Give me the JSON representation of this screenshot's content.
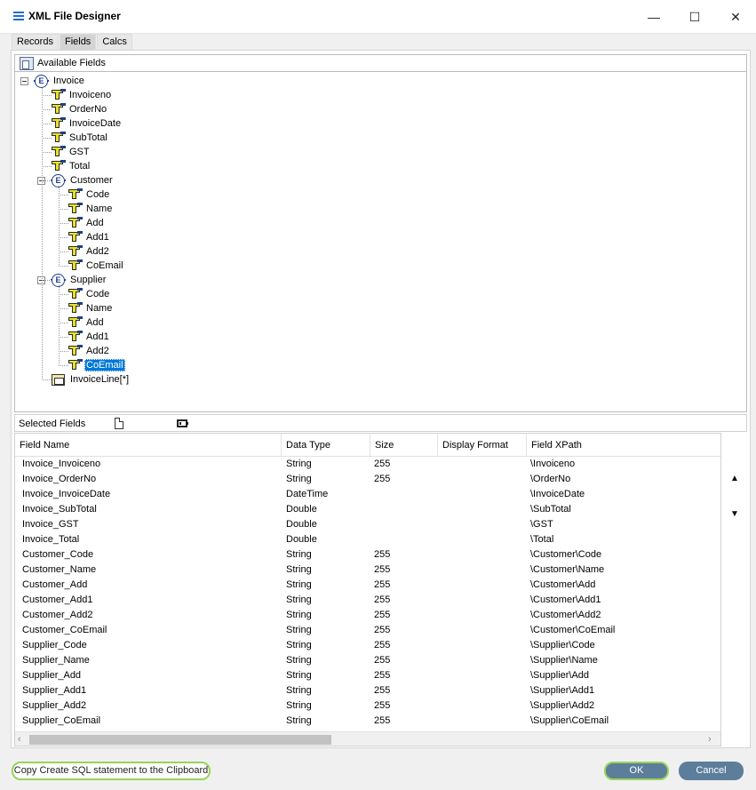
{
  "window": {
    "title": "XML File Designer",
    "minimize_glyph": "—",
    "maximize_glyph": "☐",
    "close_glyph": "✕"
  },
  "tabs": [
    {
      "label": "Records",
      "active": false
    },
    {
      "label": "Fields",
      "active": true
    },
    {
      "label": "Calcs",
      "active": false
    }
  ],
  "available_fields": {
    "label": "Available Fields",
    "tree": [
      {
        "label": "Invoice",
        "type": "element",
        "level": 0,
        "expanded": true
      },
      {
        "label": "Invoiceno",
        "type": "attribute",
        "level": 1
      },
      {
        "label": "OrderNo",
        "type": "attribute",
        "level": 1
      },
      {
        "label": "InvoiceDate",
        "type": "attribute",
        "level": 1
      },
      {
        "label": "SubTotal",
        "type": "attribute",
        "level": 1
      },
      {
        "label": "GST",
        "type": "attribute",
        "level": 1
      },
      {
        "label": "Total",
        "type": "attribute",
        "level": 1
      },
      {
        "label": "Customer",
        "type": "element",
        "level": 1,
        "expanded": true
      },
      {
        "label": "Code",
        "type": "attribute",
        "level": 2
      },
      {
        "label": "Name",
        "type": "attribute",
        "level": 2
      },
      {
        "label": "Add",
        "type": "attribute",
        "level": 2
      },
      {
        "label": "Add1",
        "type": "attribute",
        "level": 2
      },
      {
        "label": "Add2",
        "type": "attribute",
        "level": 2
      },
      {
        "label": "CoEmail",
        "type": "attribute",
        "level": 2
      },
      {
        "label": "Supplier",
        "type": "element",
        "level": 1,
        "expanded": true
      },
      {
        "label": "Code",
        "type": "attribute",
        "level": 2
      },
      {
        "label": "Name",
        "type": "attribute",
        "level": 2
      },
      {
        "label": "Add",
        "type": "attribute",
        "level": 2
      },
      {
        "label": "Add1",
        "type": "attribute",
        "level": 2
      },
      {
        "label": "Add2",
        "type": "attribute",
        "level": 2
      },
      {
        "label": "CoEmail",
        "type": "attribute",
        "level": 2,
        "selected": true
      },
      {
        "label": "InvoiceLine[*]",
        "type": "collection",
        "level": 1
      }
    ]
  },
  "selected_fields": {
    "label": "Selected Fields",
    "new_icon": "new-document-icon",
    "film_icon": "film-strip-icon",
    "columns": [
      "Field Name",
      "Data Type",
      "Size",
      "Display Format",
      "Field XPath"
    ],
    "rows": [
      [
        "Invoice_Invoiceno",
        "String",
        "255",
        "",
        "\\Invoiceno"
      ],
      [
        "Invoice_OrderNo",
        "String",
        "255",
        "",
        "\\OrderNo"
      ],
      [
        "Invoice_InvoiceDate",
        "DateTime",
        "",
        "",
        "\\InvoiceDate"
      ],
      [
        "Invoice_SubTotal",
        "Double",
        "",
        "",
        "\\SubTotal"
      ],
      [
        "Invoice_GST",
        "Double",
        "",
        "",
        "\\GST"
      ],
      [
        "Invoice_Total",
        "Double",
        "",
        "",
        "\\Total"
      ],
      [
        "Customer_Code",
        "String",
        "255",
        "",
        "\\Customer\\Code"
      ],
      [
        "Customer_Name",
        "String",
        "255",
        "",
        "\\Customer\\Name"
      ],
      [
        "Customer_Add",
        "String",
        "255",
        "",
        "\\Customer\\Add"
      ],
      [
        "Customer_Add1",
        "String",
        "255",
        "",
        "\\Customer\\Add1"
      ],
      [
        "Customer_Add2",
        "String",
        "255",
        "",
        "\\Customer\\Add2"
      ],
      [
        "Customer_CoEmail",
        "String",
        "255",
        "",
        "\\Customer\\CoEmail"
      ],
      [
        "Supplier_Code",
        "String",
        "255",
        "",
        "\\Supplier\\Code"
      ],
      [
        "Supplier_Name",
        "String",
        "255",
        "",
        "\\Supplier\\Name"
      ],
      [
        "Supplier_Add",
        "String",
        "255",
        "",
        "\\Supplier\\Add"
      ],
      [
        "Supplier_Add1",
        "String",
        "255",
        "",
        "\\Supplier\\Add1"
      ],
      [
        "Supplier_Add2",
        "String",
        "255",
        "",
        "\\Supplier\\Add2"
      ],
      [
        "Supplier_CoEmail",
        "String",
        "255",
        "",
        "\\Supplier\\CoEmail"
      ]
    ],
    "move_up_glyph": "▲",
    "move_down_glyph": "▼",
    "scroll_left_glyph": "‹",
    "scroll_right_glyph": "›"
  },
  "footer": {
    "copy_sql_label": "Copy Create SQL statement to the Clipboard",
    "ok_label": "OK",
    "cancel_label": "Cancel"
  }
}
